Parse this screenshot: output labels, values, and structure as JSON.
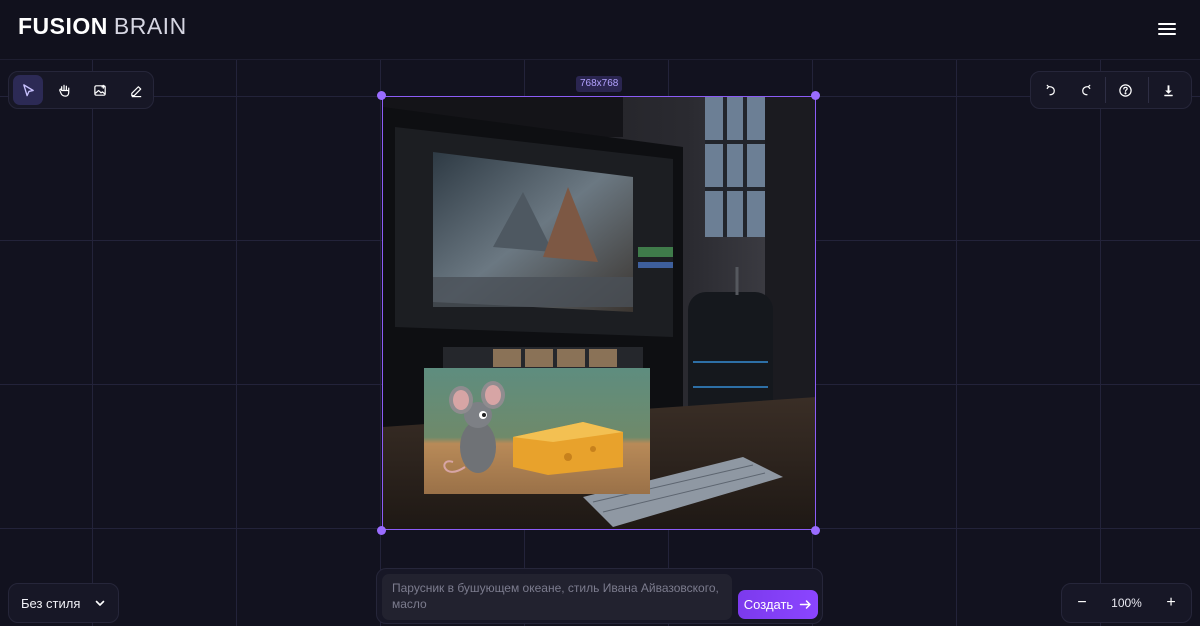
{
  "header": {
    "logo_bold": "FUSION",
    "logo_light": "BRAIN",
    "menu_icon": "hamburger-menu-icon"
  },
  "left_toolbar": {
    "tools": [
      {
        "icon": "select-cursor-icon",
        "active": true
      },
      {
        "icon": "hand-pan-icon",
        "active": false
      },
      {
        "icon": "add-image-icon",
        "active": false
      },
      {
        "icon": "eraser-icon",
        "active": false
      }
    ]
  },
  "right_toolbar": {
    "tools": [
      {
        "icon": "undo-icon"
      },
      {
        "icon": "redo-icon"
      },
      {
        "icon": "help-icon"
      },
      {
        "icon": "download-icon"
      }
    ]
  },
  "canvas": {
    "size_label": "768x768"
  },
  "style_select": {
    "value": "Без стиля",
    "icon": "chevron-down-icon"
  },
  "prompt": {
    "placeholder": "Парусник в бушующем океане, стиль Ивана Айвазовского, масло",
    "create_label": "Создать",
    "create_icon": "arrow-right-icon"
  },
  "zoom": {
    "minus": "−",
    "value": "100%",
    "plus": "+"
  },
  "colors": {
    "accent": "#8b5cf6",
    "background": "#12121f",
    "panel": "#171726"
  }
}
